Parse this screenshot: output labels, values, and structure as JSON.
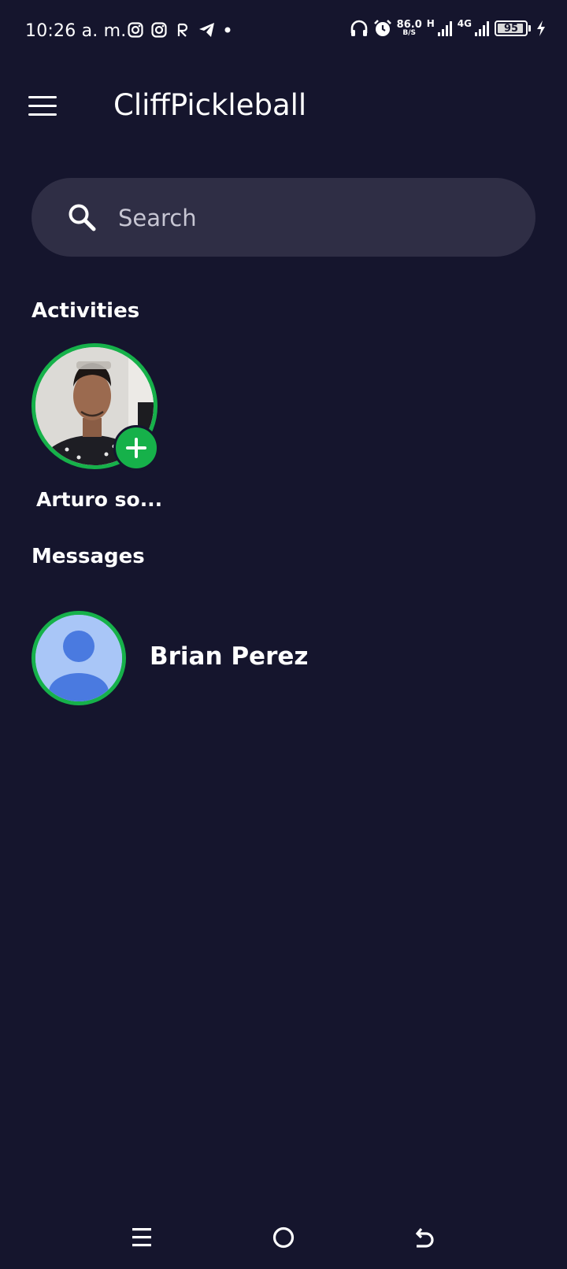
{
  "status_bar": {
    "time": "10:26 a. m.",
    "left_icons": [
      "instagram-icon",
      "instagram-icon",
      "r-app-icon",
      "telegram-icon",
      "dot-icon"
    ],
    "net_speed_value": "86.0",
    "net_speed_unit": "B/S",
    "signal_1_tag": "H",
    "signal_2_tag": "4G",
    "battery_level": "95"
  },
  "app": {
    "title": "CliffPickleball"
  },
  "search": {
    "placeholder": "Search"
  },
  "activities": {
    "heading": "Activities",
    "items": [
      {
        "name": "Arturo so..."
      }
    ]
  },
  "messages": {
    "heading": "Messages",
    "items": [
      {
        "name": "Brian Perez"
      }
    ]
  },
  "colors": {
    "background": "#15152d",
    "search_bg": "#2f2e45",
    "accent_green": "#16b14a",
    "avatar_placeholder_bg": "#a9c6f7",
    "avatar_placeholder_fg": "#4a7ae0"
  }
}
